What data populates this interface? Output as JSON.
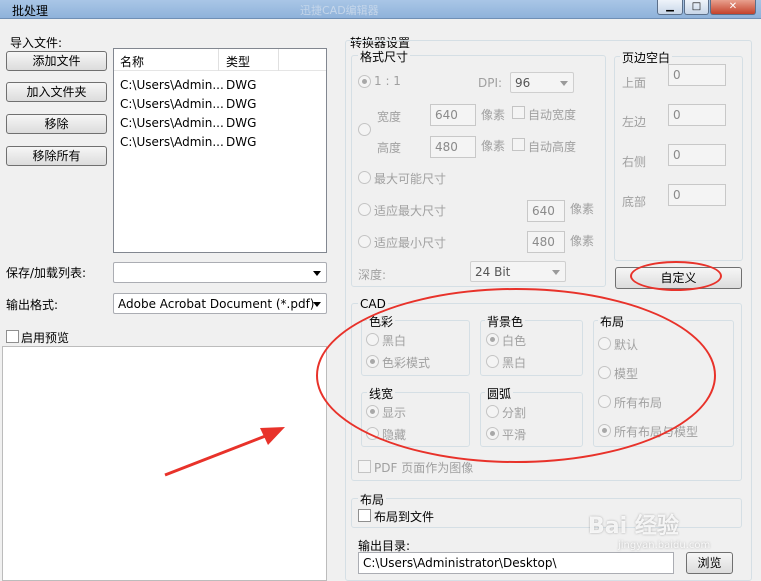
{
  "window": {
    "title": "批处理",
    "blurred_title": "迅捷CAD编辑器",
    "minimize": "▁",
    "maximize": "□",
    "close": "✕"
  },
  "import": {
    "group_label": "导入文件:",
    "add_file": "添加文件",
    "add_folder": "加入文件夹",
    "remove": "移除",
    "remove_all": "移除所有",
    "columns": [
      "名称",
      "类型"
    ],
    "files": [
      {
        "name": "C:\\Users\\Admin...",
        "type": "DWG"
      },
      {
        "name": "C:\\Users\\Admin...",
        "type": "DWG"
      },
      {
        "name": "C:\\Users\\Admin...",
        "type": "DWG"
      },
      {
        "name": "C:\\Users\\Admin...",
        "type": "DWG"
      }
    ],
    "save_load_label": "保存/加载列表:",
    "save_load_value": "",
    "output_format_label": "输出格式:",
    "output_format_value": "Adobe Acrobat Document (*.pdf)",
    "preview_label": "启用预览"
  },
  "converter": {
    "group_label": "转换器设置",
    "format_size": {
      "label": "格式尺寸",
      "ratio": "1 : 1",
      "dpi_label": "DPI:",
      "dpi_value": "96",
      "width_label": "宽度",
      "width_value": "640",
      "height_label": "高度",
      "height_value": "480",
      "pixels": "像素",
      "auto_width": "自动宽度",
      "auto_height": "自动高度",
      "max_size": "最大可能尺寸",
      "fit_max": "适应最大尺寸",
      "fit_max_value": "640",
      "fit_min": "适应最小尺寸",
      "fit_min_value": "480",
      "depth_label": "深度:",
      "depth_value": "24 Bit"
    },
    "margins": {
      "label": "页边空白",
      "top_label": "上面",
      "top_value": "0",
      "left_label": "左边",
      "left_value": "0",
      "right_label": "右侧",
      "right_value": "0",
      "bottom_label": "底部",
      "bottom_value": "0",
      "custom_button": "自定义"
    },
    "cad": {
      "label": "CAD",
      "color": {
        "label": "色彩",
        "options": [
          "黑白",
          "色彩模式"
        ],
        "selected": 1
      },
      "background": {
        "label": "背景色",
        "options": [
          "白色",
          "黑白"
        ],
        "selected": 0
      },
      "layout": {
        "label": "布局",
        "options": [
          "默认",
          "模型",
          "所有布局",
          "所有布局与模型"
        ],
        "selected": 3
      },
      "line_width": {
        "label": "线宽",
        "options": [
          "显示",
          "隐藏"
        ],
        "selected": 0
      },
      "arc": {
        "label": "圆弧",
        "options": [
          "分割",
          "平滑"
        ],
        "selected": 1
      },
      "pdf_as_image": "PDF 页面作为图像"
    },
    "layout_group": {
      "label": "布局",
      "layout_to_file": "布局到文件"
    },
    "output_dir": {
      "label": "输出目录:",
      "value": "C:\\Users\\Administrator\\Desktop\\",
      "browse": "浏览"
    }
  },
  "watermark": {
    "text": "Bai 经验",
    "sub": "jingyan.baidu.com"
  },
  "annotation_colors": {
    "red": "#e8322a"
  }
}
